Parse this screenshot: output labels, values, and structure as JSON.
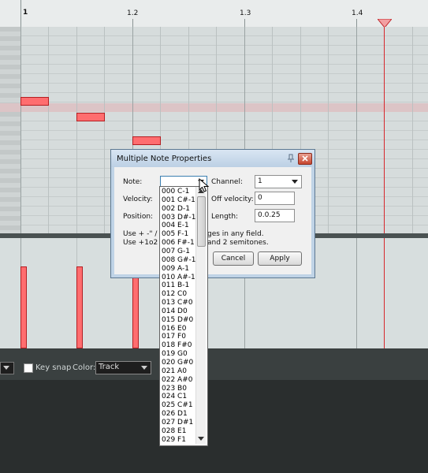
{
  "ruler": {
    "bar1": "1",
    "bar1_2": "1.2",
    "bar1_3": "1.3",
    "bar1_4": "1.4"
  },
  "toolbar": {
    "key_snap_label": "Key snap",
    "color_label": "Color:",
    "color_value": "Track"
  },
  "dialog": {
    "title": "Multiple Note Properties",
    "note_label": "Note:",
    "note_value": "",
    "channel_label": "Channel:",
    "channel_value": "1",
    "velocity_label": "Velocity:",
    "off_velocity_label": "Off velocity:",
    "off_velocity_value": "0",
    "position_label": "Position:",
    "length_label": "Length:",
    "length_value": "0.0.25",
    "hint_line1_prefix": "Use + -\" / fo",
    "hint_line1_suffix": "ges in any field.",
    "hint_line2_prefix": "Use +1o2 t",
    "hint_line2_suffix": "and 2 semitones.",
    "cancel": "Cancel",
    "apply": "Apply"
  },
  "note_list": [
    "000 C-1",
    "001 C#-1",
    "002 D-1",
    "003 D#-1",
    "004 E-1",
    "005 F-1",
    "006 F#-1",
    "007 G-1",
    "008 G#-1",
    "009 A-1",
    "010 A#-1",
    "011 B-1",
    "012 C0",
    "013 C#0",
    "014 D0",
    "015 D#0",
    "016 E0",
    "017 F0",
    "018 F#0",
    "019 G0",
    "020 G#0",
    "021 A0",
    "022 A#0",
    "023 B0",
    "024 C1",
    "025 C#1",
    "026 D1",
    "027 D#1",
    "028 E1",
    "029 F1"
  ],
  "colors": {
    "note_fill": "#ff6d6f",
    "note_border": "#b31e22",
    "cursor": "#d7262b"
  }
}
